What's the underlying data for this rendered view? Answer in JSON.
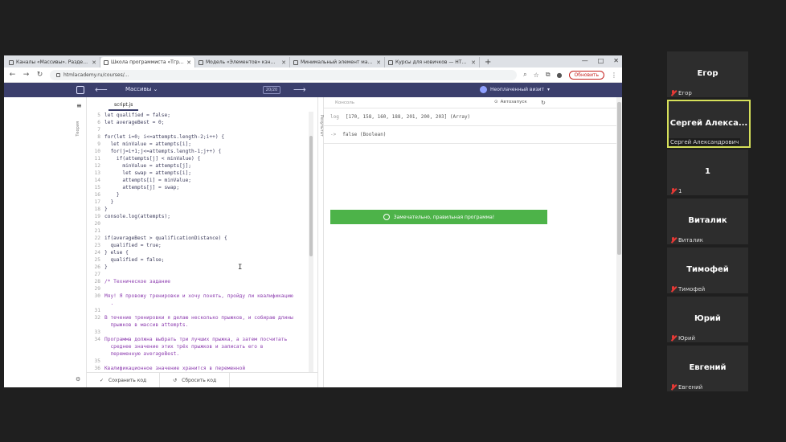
{
  "browser": {
    "tabs": [
      {
        "label": "Каналы «Массивы». Раздел 2 ..."
      },
      {
        "label": "Школа программиста «Тгр»дан..."
      },
      {
        "label": "Модель «Элементов» кзн..."
      },
      {
        "label": "Минимальный элемент массива..."
      },
      {
        "label": "Курсы для новичков — HTML, ..."
      }
    ],
    "new_tab": "+",
    "window_controls": [
      "—",
      "□",
      "✕"
    ],
    "url": "htmlacademy.ru/courses/...",
    "update_button": "Обновить"
  },
  "app": {
    "section": "Массивы",
    "step": "20/20",
    "user": "Неоплаченный визит",
    "left_panel_label": "Теория",
    "file_tab": "script.js",
    "code_lines": [
      {
        "n": "5",
        "t": "let qualified = false;",
        "c": false
      },
      {
        "n": "6",
        "t": "let averageBest = 0;",
        "c": false
      },
      {
        "n": "7",
        "t": "",
        "c": false
      },
      {
        "n": "8",
        "t": "for(let i=0; i<=attempts.length-2;i++) {",
        "c": false
      },
      {
        "n": "9",
        "t": "  let minValue = attempts[i];",
        "c": false
      },
      {
        "n": "10",
        "t": "  for(j=i+1;j<=attempts.length-1;j++) {",
        "c": false
      },
      {
        "n": "11",
        "t": "    if(attempts[j] < minValue) {",
        "c": false
      },
      {
        "n": "12",
        "t": "      minValue = attempts[j];",
        "c": false
      },
      {
        "n": "13",
        "t": "      let swap = attempts[i];",
        "c": false
      },
      {
        "n": "14",
        "t": "      attempts[i] = minValue;",
        "c": false
      },
      {
        "n": "15",
        "t": "      attempts[j] = swap;",
        "c": false
      },
      {
        "n": "16",
        "t": "    }",
        "c": false
      },
      {
        "n": "17",
        "t": "  }",
        "c": false
      },
      {
        "n": "18",
        "t": "}",
        "c": false
      },
      {
        "n": "19",
        "t": "console.log(attempts);",
        "c": false
      },
      {
        "n": "20",
        "t": "",
        "c": false
      },
      {
        "n": "21",
        "t": "",
        "c": false
      },
      {
        "n": "22",
        "t": "if(averageBest > qualificationDistance) {",
        "c": false
      },
      {
        "n": "23",
        "t": "  qualified = true;",
        "c": false
      },
      {
        "n": "24",
        "t": "} else {",
        "c": false
      },
      {
        "n": "25",
        "t": "  qualified = false;",
        "c": false
      },
      {
        "n": "26",
        "t": "}",
        "c": false
      },
      {
        "n": "27",
        "t": "",
        "c": false
      },
      {
        "n": "28",
        "t": "/* Техническое задание",
        "c": true
      },
      {
        "n": "29",
        "t": "",
        "c": true
      },
      {
        "n": "30",
        "t": "Мяу! Я провожу тренировки и хочу понять, пройду ли квалификацию",
        "c": true
      },
      {
        "n": "",
        "t": "  .",
        "c": true
      },
      {
        "n": "31",
        "t": "",
        "c": true
      },
      {
        "n": "32",
        "t": "В течение тренировки я делаю несколько прыжков, и собираю длины",
        "c": true
      },
      {
        "n": "",
        "t": "  прыжков в массив attempts.",
        "c": true
      },
      {
        "n": "33",
        "t": "",
        "c": true
      },
      {
        "n": "34",
        "t": "Программа должна выбрать три лучших прыжка, а затем посчитать",
        "c": true
      },
      {
        "n": "",
        "t": "  среднее значение этих трёх прыжков и записать его в",
        "c": true
      },
      {
        "n": "",
        "t": "  переменную averageBest.",
        "c": true
      },
      {
        "n": "35",
        "t": "",
        "c": true
      },
      {
        "n": "36",
        "t": "Квалификационное значение хранится в переменной",
        "c": true
      }
    ],
    "save_button": "Сохранить код",
    "reset_button": "Сбросить код",
    "result_label": "Результат",
    "console_placeholder": "Консоль",
    "autorun_label": "Автозапуск",
    "output_lines": [
      {
        "arrow": "log",
        "text": "[170, 158, 160, 188, 201, 200, 203] (Array)"
      },
      {
        "arrow": "->",
        "text": "false (Boolean)"
      }
    ],
    "success_message": "Замечательно, правильная программа!"
  },
  "participants": [
    {
      "name": "Егор",
      "label": "Егор",
      "active": false
    },
    {
      "name": "Сергей Алекса...",
      "label": "Сергей Александрович",
      "active": true
    },
    {
      "name": "1",
      "label": "1",
      "active": false
    },
    {
      "name": "Виталик",
      "label": "Виталик",
      "active": false
    },
    {
      "name": "Тимофей",
      "label": "Тимофей",
      "active": false
    },
    {
      "name": "Юрий",
      "label": "Юрий",
      "active": false
    },
    {
      "name": "Евгений",
      "label": "Евгений",
      "active": false
    }
  ],
  "colors": {
    "app_header": "#3b3f6c",
    "success": "#4db349",
    "active_tile_border": "#d6e05a",
    "muted_mic": "#e53935"
  }
}
